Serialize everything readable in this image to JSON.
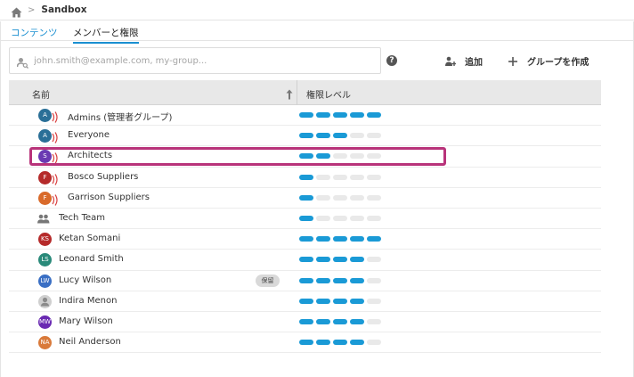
{
  "breadcrumb": {
    "separator": ">",
    "current": "Sandbox"
  },
  "tabs": [
    {
      "label": "コンテンツ",
      "active": false
    },
    {
      "label": "メンバーと権限",
      "active": true
    }
  ],
  "toolbar": {
    "search_placeholder": "john.smith@example.com, my-group...",
    "help": "?",
    "add_label": "追加",
    "create_group_label": "グループを作成"
  },
  "grid": {
    "col_name": "名前",
    "col_level": "権限レベル",
    "rows": [
      {
        "name": "Admins (管理者グループ)",
        "avatar": "A",
        "type": "group",
        "color": "#2a6f97",
        "level": 5
      },
      {
        "name": "Everyone",
        "avatar": "A",
        "type": "group",
        "color": "#2a6f97",
        "level": 3
      },
      {
        "name": "Architects",
        "avatar": "S",
        "type": "group",
        "color": "#6a3ab2",
        "level": 2
      },
      {
        "name": "Bosco Suppliers",
        "avatar": "F",
        "type": "group",
        "color": "#b52a2a",
        "level": 1
      },
      {
        "name": "Garrison Suppliers",
        "avatar": "F",
        "type": "group",
        "color": "#d96a2a",
        "level": 1
      },
      {
        "name": "Tech Team",
        "avatar": "",
        "type": "team",
        "color": "#666666",
        "level": 1
      },
      {
        "name": "Ketan Somani",
        "avatar": "KS",
        "type": "user",
        "color": "#b52a2a",
        "level": 5
      },
      {
        "name": "Leonard Smith",
        "avatar": "LS",
        "type": "user",
        "color": "#2a8a7a",
        "level": 4
      },
      {
        "name": "Lucy Wilson",
        "avatar": "LW",
        "type": "user",
        "color": "#3a6fc4",
        "level": 4,
        "badge": "保留"
      },
      {
        "name": "Indira Menon",
        "avatar": "",
        "type": "user-generic",
        "color": "#cfcfcf",
        "level": 4
      },
      {
        "name": "Mary Wilson",
        "avatar": "MW",
        "type": "user",
        "color": "#6a2ab2",
        "level": 4
      },
      {
        "name": "Neil Anderson",
        "avatar": "NA",
        "type": "user",
        "color": "#d97a3a",
        "level": 4
      }
    ]
  },
  "accent_color": "#1a9ad6",
  "highlight_color": "#b8337a"
}
